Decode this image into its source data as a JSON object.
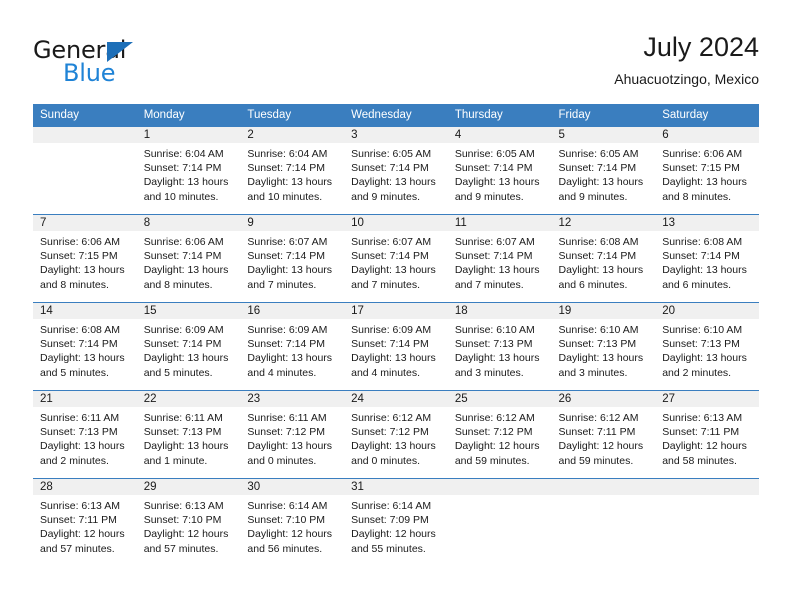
{
  "brand": {
    "word_one": "General",
    "word_two": "Blue",
    "accent_color": "#1f83d6",
    "triangle_color": "#1d6fb8",
    "logo_icon": "triangle-flag-icon"
  },
  "header": {
    "title": "July 2024",
    "subtitle": "Ahuacuotzingo, Mexico"
  },
  "calendar": {
    "header_bg": "#3a7ebf",
    "daynum_bg": "#f0f0f0",
    "weekday_headers": [
      "Sunday",
      "Monday",
      "Tuesday",
      "Wednesday",
      "Thursday",
      "Friday",
      "Saturday"
    ],
    "weeks": [
      [
        {
          "day": "",
          "sunrise": "",
          "sunset": "",
          "daylight_a": "",
          "daylight_b": ""
        },
        {
          "day": "1",
          "sunrise": "Sunrise: 6:04 AM",
          "sunset": "Sunset: 7:14 PM",
          "daylight_a": "Daylight: 13 hours",
          "daylight_b": "and 10 minutes."
        },
        {
          "day": "2",
          "sunrise": "Sunrise: 6:04 AM",
          "sunset": "Sunset: 7:14 PM",
          "daylight_a": "Daylight: 13 hours",
          "daylight_b": "and 10 minutes."
        },
        {
          "day": "3",
          "sunrise": "Sunrise: 6:05 AM",
          "sunset": "Sunset: 7:14 PM",
          "daylight_a": "Daylight: 13 hours",
          "daylight_b": "and 9 minutes."
        },
        {
          "day": "4",
          "sunrise": "Sunrise: 6:05 AM",
          "sunset": "Sunset: 7:14 PM",
          "daylight_a": "Daylight: 13 hours",
          "daylight_b": "and 9 minutes."
        },
        {
          "day": "5",
          "sunrise": "Sunrise: 6:05 AM",
          "sunset": "Sunset: 7:14 PM",
          "daylight_a": "Daylight: 13 hours",
          "daylight_b": "and 9 minutes."
        },
        {
          "day": "6",
          "sunrise": "Sunrise: 6:06 AM",
          "sunset": "Sunset: 7:15 PM",
          "daylight_a": "Daylight: 13 hours",
          "daylight_b": "and 8 minutes."
        }
      ],
      [
        {
          "day": "7",
          "sunrise": "Sunrise: 6:06 AM",
          "sunset": "Sunset: 7:15 PM",
          "daylight_a": "Daylight: 13 hours",
          "daylight_b": "and 8 minutes."
        },
        {
          "day": "8",
          "sunrise": "Sunrise: 6:06 AM",
          "sunset": "Sunset: 7:14 PM",
          "daylight_a": "Daylight: 13 hours",
          "daylight_b": "and 8 minutes."
        },
        {
          "day": "9",
          "sunrise": "Sunrise: 6:07 AM",
          "sunset": "Sunset: 7:14 PM",
          "daylight_a": "Daylight: 13 hours",
          "daylight_b": "and 7 minutes."
        },
        {
          "day": "10",
          "sunrise": "Sunrise: 6:07 AM",
          "sunset": "Sunset: 7:14 PM",
          "daylight_a": "Daylight: 13 hours",
          "daylight_b": "and 7 minutes."
        },
        {
          "day": "11",
          "sunrise": "Sunrise: 6:07 AM",
          "sunset": "Sunset: 7:14 PM",
          "daylight_a": "Daylight: 13 hours",
          "daylight_b": "and 7 minutes."
        },
        {
          "day": "12",
          "sunrise": "Sunrise: 6:08 AM",
          "sunset": "Sunset: 7:14 PM",
          "daylight_a": "Daylight: 13 hours",
          "daylight_b": "and 6 minutes."
        },
        {
          "day": "13",
          "sunrise": "Sunrise: 6:08 AM",
          "sunset": "Sunset: 7:14 PM",
          "daylight_a": "Daylight: 13 hours",
          "daylight_b": "and 6 minutes."
        }
      ],
      [
        {
          "day": "14",
          "sunrise": "Sunrise: 6:08 AM",
          "sunset": "Sunset: 7:14 PM",
          "daylight_a": "Daylight: 13 hours",
          "daylight_b": "and 5 minutes."
        },
        {
          "day": "15",
          "sunrise": "Sunrise: 6:09 AM",
          "sunset": "Sunset: 7:14 PM",
          "daylight_a": "Daylight: 13 hours",
          "daylight_b": "and 5 minutes."
        },
        {
          "day": "16",
          "sunrise": "Sunrise: 6:09 AM",
          "sunset": "Sunset: 7:14 PM",
          "daylight_a": "Daylight: 13 hours",
          "daylight_b": "and 4 minutes."
        },
        {
          "day": "17",
          "sunrise": "Sunrise: 6:09 AM",
          "sunset": "Sunset: 7:14 PM",
          "daylight_a": "Daylight: 13 hours",
          "daylight_b": "and 4 minutes."
        },
        {
          "day": "18",
          "sunrise": "Sunrise: 6:10 AM",
          "sunset": "Sunset: 7:13 PM",
          "daylight_a": "Daylight: 13 hours",
          "daylight_b": "and 3 minutes."
        },
        {
          "day": "19",
          "sunrise": "Sunrise: 6:10 AM",
          "sunset": "Sunset: 7:13 PM",
          "daylight_a": "Daylight: 13 hours",
          "daylight_b": "and 3 minutes."
        },
        {
          "day": "20",
          "sunrise": "Sunrise: 6:10 AM",
          "sunset": "Sunset: 7:13 PM",
          "daylight_a": "Daylight: 13 hours",
          "daylight_b": "and 2 minutes."
        }
      ],
      [
        {
          "day": "21",
          "sunrise": "Sunrise: 6:11 AM",
          "sunset": "Sunset: 7:13 PM",
          "daylight_a": "Daylight: 13 hours",
          "daylight_b": "and 2 minutes."
        },
        {
          "day": "22",
          "sunrise": "Sunrise: 6:11 AM",
          "sunset": "Sunset: 7:13 PM",
          "daylight_a": "Daylight: 13 hours",
          "daylight_b": "and 1 minute."
        },
        {
          "day": "23",
          "sunrise": "Sunrise: 6:11 AM",
          "sunset": "Sunset: 7:12 PM",
          "daylight_a": "Daylight: 13 hours",
          "daylight_b": "and 0 minutes."
        },
        {
          "day": "24",
          "sunrise": "Sunrise: 6:12 AM",
          "sunset": "Sunset: 7:12 PM",
          "daylight_a": "Daylight: 13 hours",
          "daylight_b": "and 0 minutes."
        },
        {
          "day": "25",
          "sunrise": "Sunrise: 6:12 AM",
          "sunset": "Sunset: 7:12 PM",
          "daylight_a": "Daylight: 12 hours",
          "daylight_b": "and 59 minutes."
        },
        {
          "day": "26",
          "sunrise": "Sunrise: 6:12 AM",
          "sunset": "Sunset: 7:11 PM",
          "daylight_a": "Daylight: 12 hours",
          "daylight_b": "and 59 minutes."
        },
        {
          "day": "27",
          "sunrise": "Sunrise: 6:13 AM",
          "sunset": "Sunset: 7:11 PM",
          "daylight_a": "Daylight: 12 hours",
          "daylight_b": "and 58 minutes."
        }
      ],
      [
        {
          "day": "28",
          "sunrise": "Sunrise: 6:13 AM",
          "sunset": "Sunset: 7:11 PM",
          "daylight_a": "Daylight: 12 hours",
          "daylight_b": "and 57 minutes."
        },
        {
          "day": "29",
          "sunrise": "Sunrise: 6:13 AM",
          "sunset": "Sunset: 7:10 PM",
          "daylight_a": "Daylight: 12 hours",
          "daylight_b": "and 57 minutes."
        },
        {
          "day": "30",
          "sunrise": "Sunrise: 6:14 AM",
          "sunset": "Sunset: 7:10 PM",
          "daylight_a": "Daylight: 12 hours",
          "daylight_b": "and 56 minutes."
        },
        {
          "day": "31",
          "sunrise": "Sunrise: 6:14 AM",
          "sunset": "Sunset: 7:09 PM",
          "daylight_a": "Daylight: 12 hours",
          "daylight_b": "and 55 minutes."
        },
        {
          "day": "",
          "sunrise": "",
          "sunset": "",
          "daylight_a": "",
          "daylight_b": ""
        },
        {
          "day": "",
          "sunrise": "",
          "sunset": "",
          "daylight_a": "",
          "daylight_b": ""
        },
        {
          "day": "",
          "sunrise": "",
          "sunset": "",
          "daylight_a": "",
          "daylight_b": ""
        }
      ]
    ]
  }
}
